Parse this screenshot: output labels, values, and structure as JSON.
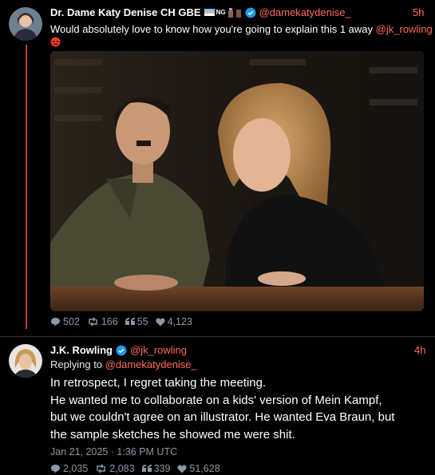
{
  "tweet1": {
    "display_name": "Dr. Dame Katy Denise CH GBE",
    "name_emojis": "NG",
    "handle": "@damekatydenise_",
    "time": "5h",
    "text": "Would absolutely love to know how you're going to explain this 1 away",
    "mention": "@jk_rowling",
    "stats": {
      "replies": "502",
      "retweets": "166",
      "quotes": "55",
      "likes": "4,123"
    }
  },
  "tweet2": {
    "display_name": "J.K. Rowling",
    "handle": "@jk_rowling",
    "time": "4h",
    "replying_prefix": "Replying to",
    "replying_to": "@damekatydenise_",
    "lines": [
      "In retrospect, I regret taking the meeting.",
      "He wanted me to collaborate on a kids' version of Mein Kampf,",
      "but we couldn't agree on an illustrator. He wanted Eva Braun, but",
      "the sample sketches he showed me were shit."
    ],
    "date": "Jan 21, 2025 · 1:36 PM UTC",
    "stats": {
      "replies": "2,035",
      "retweets": "2,083",
      "quotes": "339",
      "likes": "51,628"
    }
  },
  "colors": {
    "accent": "#ff6b5b",
    "verified": "#1d9bf0",
    "muted": "#8b98a5",
    "thread": "#c23a33"
  },
  "icons": [
    "verified-badge-icon",
    "reply-icon",
    "retweet-icon",
    "quote-icon",
    "heart-icon",
    "angry-face-emoji-icon"
  ]
}
